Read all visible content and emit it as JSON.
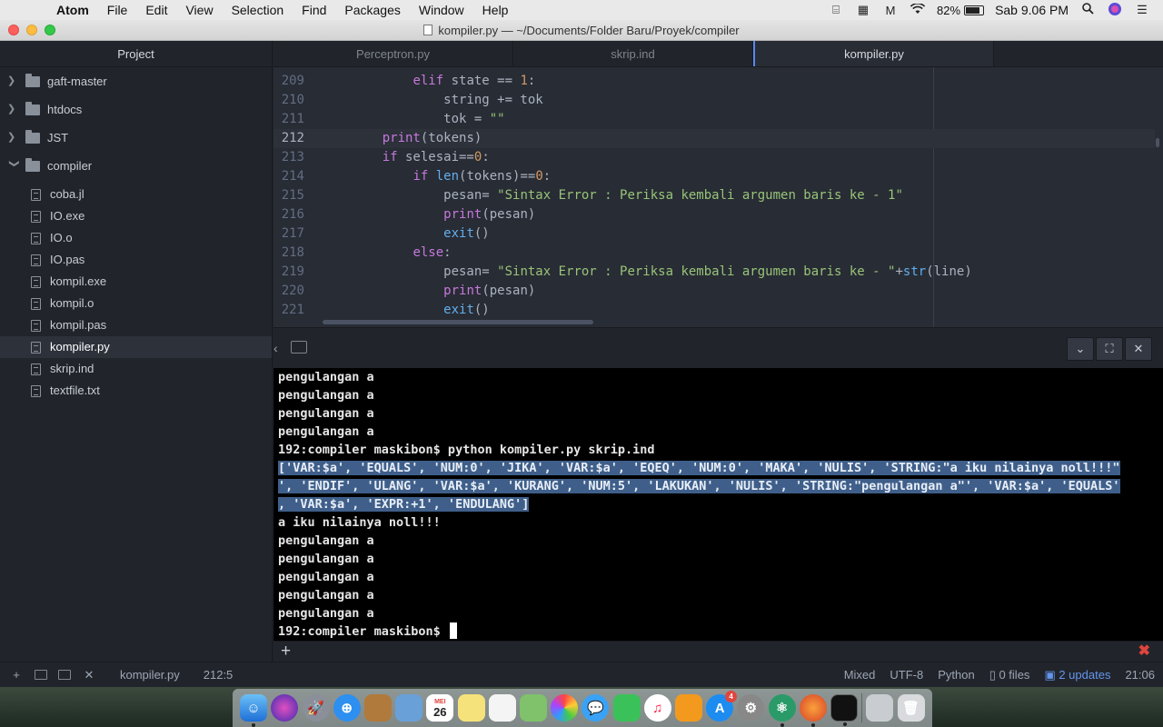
{
  "menubar": {
    "apple_glyph": "",
    "app_name": "Atom",
    "items": [
      "File",
      "Edit",
      "View",
      "Selection",
      "Find",
      "Packages",
      "Window",
      "Help"
    ],
    "battery_percent": "82%",
    "battery_level": 0.82,
    "clock": "Sab 9.06 PM"
  },
  "window": {
    "title": "kompiler.py — ~/Documents/Folder Baru/Proyek/compiler"
  },
  "sidebar": {
    "header": "Project",
    "folders": [
      {
        "name": "gaft-master",
        "expanded": false
      },
      {
        "name": "htdocs",
        "expanded": false
      },
      {
        "name": "JST",
        "expanded": false
      },
      {
        "name": "compiler",
        "expanded": true
      }
    ],
    "files": [
      "coba.jl",
      "IO.exe",
      "IO.o",
      "IO.pas",
      "kompil.exe",
      "kompil.o",
      "kompil.pas",
      "kompiler.py",
      "skrip.ind",
      "textfile.txt"
    ],
    "selected_file": "kompiler.py"
  },
  "tabs": [
    {
      "label": "Perceptron.py",
      "active": false
    },
    {
      "label": "skrip.ind",
      "active": false
    },
    {
      "label": "kompiler.py",
      "active": true
    }
  ],
  "editor": {
    "line_numbers": [
      "209",
      "210",
      "211",
      "212",
      "213",
      "214",
      "215",
      "216",
      "217",
      "218",
      "219",
      "220",
      "221"
    ],
    "cursor_line_index": 3
  },
  "terminal": {
    "lines_before": [
      "pengulangan a",
      "pengulangan a",
      "pengulangan a",
      "pengulangan a"
    ],
    "command_line": "192:compiler maskibon$ python kompiler.py skrip.ind",
    "selected_lines": [
      "['VAR:$a', 'EQUALS', 'NUM:0', 'JIKA', 'VAR:$a', 'EQEQ', 'NUM:0', 'MAKA', 'NULIS', 'STRING:\"a iku nilainya noll!!!\"",
      "', 'ENDIF', 'ULANG', 'VAR:$a', 'KURANG', 'NUM:5', 'LAKUKAN', 'NULIS', 'STRING:\"pengulangan a\"', 'VAR:$a', 'EQUALS'",
      ", 'VAR:$a', 'EXPR:+1', 'ENDULANG']"
    ],
    "lines_after": [
      "a iku nilainya noll!!!",
      "pengulangan a",
      "pengulangan a",
      "pengulangan a",
      "pengulangan a",
      "pengulangan a"
    ],
    "prompt": "192:compiler maskibon$ "
  },
  "statusbar": {
    "file": "kompiler.py",
    "position": "212:5",
    "line_ending": "Mixed",
    "encoding": "UTF-8",
    "grammar": "Python",
    "git_files": "0 files",
    "updates": "2 updates",
    "time": "21:06"
  },
  "dock": {
    "calendar_day": "26",
    "calendar_month": "MEI",
    "appstore_badge": "4"
  },
  "colors": {
    "accent": "#568af2",
    "selection": "#3f5f8a",
    "keyword": "#c678dd",
    "string": "#98c379",
    "number": "#d19a66",
    "function": "#61afef",
    "error_red": "#e0443e"
  }
}
